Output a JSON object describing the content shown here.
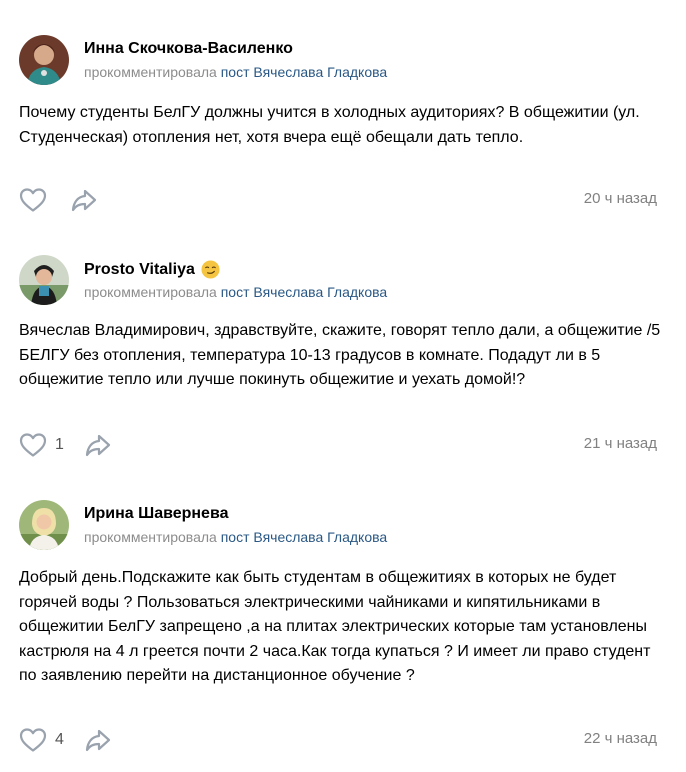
{
  "comments": [
    {
      "author": "Инна Скочкова-Василенко",
      "action": "прокомментировала",
      "post_link": "пост Вячеслава Гладкова",
      "text": "Почему студенты БелГУ должны учится в холодных аудиториях? В общежитии (ул. Студенческая) отопления нет, хотя вчера ещё обещали дать тепло.",
      "likes": "",
      "time": "20 ч назад"
    },
    {
      "author": "Prosto Vitaliya",
      "action": "прокомментировала",
      "post_link": "пост Вячеслава Гладкова",
      "text": "Вячеслав Владимирович, здравствуйте, скажите, говорят тепло дали, а общежитие /5 БЕЛГУ без отопления, температура 10-13 градусов в комнате. Подадут ли в 5 общежитие тепло или лучше покинуть общежитие и уехать домой!?",
      "likes": "1",
      "time": "21 ч назад"
    },
    {
      "author": "Ирина Шавернева",
      "action": "прокомментировала",
      "post_link": "пост Вячеслава Гладкова",
      "text": "Добрый день.Подскажите как быть студентам в общежитиях в которых не будет горячей воды ? Пользоваться электрическими чайниками и кипятильниками в общежитии БелГУ запрещено ,а на плитах электрических которые там установлены кастрюля на 4 л греется почти 2 часа.Как тогда купаться ? И имеет ли право студент по заявлению перейти на дистанционное обучение ?",
      "likes": "4",
      "time": "22 ч назад"
    }
  ],
  "icons": {
    "like": "heart-outline-icon",
    "share": "share-arrow-icon",
    "emoji": "smirking-face-emoji"
  },
  "colors": {
    "link": "#2a5885",
    "muted": "#8c8c8c",
    "icon": "#99a2ad"
  }
}
